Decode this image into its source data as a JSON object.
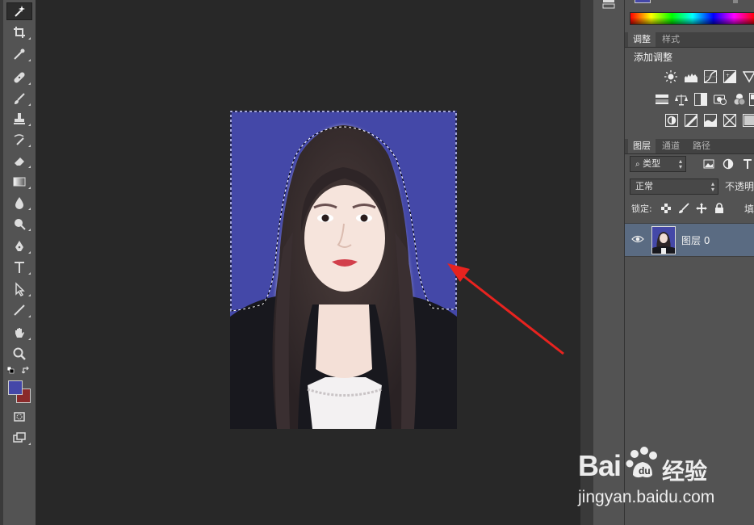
{
  "tools": [
    {
      "name": "magic-wand-icon",
      "active": true
    },
    {
      "name": "crop-icon"
    },
    {
      "name": "eyedropper-icon"
    },
    {
      "name": "healing-brush-icon"
    },
    {
      "name": "brush-icon"
    },
    {
      "name": "clone-stamp-icon"
    },
    {
      "name": "history-brush-icon"
    },
    {
      "name": "eraser-icon"
    },
    {
      "name": "gradient-icon"
    },
    {
      "name": "blur-icon"
    },
    {
      "name": "dodge-icon"
    },
    {
      "name": "pen-icon"
    },
    {
      "name": "type-icon"
    },
    {
      "name": "path-selection-icon"
    },
    {
      "name": "line-icon"
    },
    {
      "name": "hand-icon"
    },
    {
      "name": "zoom-icon"
    }
  ],
  "colors": {
    "foreground": "#4447a8",
    "background": "#8a2a2a",
    "photo_background": "#4448a8",
    "selected_layer": "#5a6b82",
    "arrow": "#e8231f"
  },
  "panels": {
    "adjustments_tabs": [
      "调整",
      "样式"
    ],
    "adjustments_title": "添加调整",
    "layers_tabs": [
      "图层",
      "通道",
      "路径"
    ],
    "filter_kind": "类型",
    "blend_mode": "正常",
    "opacity_label": "不透明",
    "lock_label": "锁定:",
    "fill_label": "填",
    "layer": {
      "name": "图层 0",
      "visible": true
    }
  },
  "watermark": {
    "brand_left": "Bai",
    "brand_right": "经验",
    "url": "jingyan.baidu.com"
  }
}
